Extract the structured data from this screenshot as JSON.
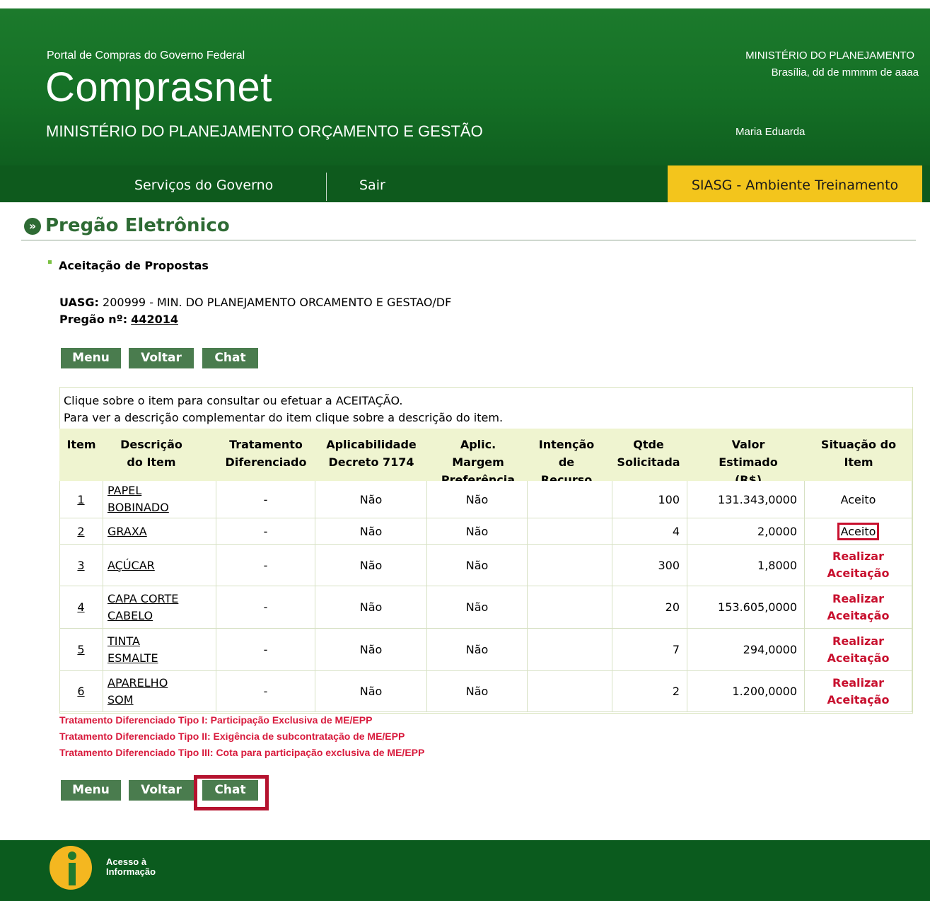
{
  "header": {
    "portal": "Portal de Compras do Governo Federal",
    "brand": "Comprasnet",
    "ministry": "MINISTÉRIO DO PLANEJAMENTO ORÇAMENTO E GESTÃO",
    "top_right": "MINISTÉRIO DO PLANEJAMENTO",
    "date": "Brasília, dd de mmmm de aaaa",
    "user": "Maria Eduarda"
  },
  "nav": {
    "items": [
      "Serviços do Governo",
      "Sair"
    ],
    "environment": "SIASG - Ambiente Treinamento"
  },
  "page": {
    "title": "Pregão Eletrônico",
    "subtitle": "Aceitação de Propostas",
    "uasg_label": "UASG:",
    "uasg_value": "200999 - MIN. DO PLANEJAMENTO ORCAMENTO E GESTAO/DF",
    "pregao_label": "Pregão nº:",
    "pregao_value": "442014"
  },
  "buttons": {
    "menu": "Menu",
    "voltar": "Voltar",
    "chat": "Chat"
  },
  "table": {
    "note1": "Clique sobre o item para consultar ou efetuar a ACEITAÇÃO.",
    "note2": "Para ver a descrição complementar do item clique sobre a descrição do item.",
    "headers": {
      "item": "Item",
      "descricao": "Descrição do Item",
      "tratamento": "Tratamento Diferenciado",
      "aplicabilidade": "Aplicabilidade Decreto 7174",
      "margem": "Aplic. Margem Preferência",
      "intencao": "Intenção de Recurso",
      "qtde": "Qtde Solicitada",
      "valor": "Valor Estimado (R$)",
      "situacao": "Situação do Item"
    },
    "rows": [
      {
        "item": "1",
        "descricao": "PAPEL BOBINADO",
        "tratamento": "-",
        "aplicabilidade": "Não",
        "margem": "Não",
        "intencao": "",
        "qtde": "100",
        "valor": "131.343,0000",
        "situacao": "Aceito"
      },
      {
        "item": "2",
        "descricao": "GRAXA",
        "tratamento": "-",
        "aplicabilidade": "Não",
        "margem": "Não",
        "intencao": "",
        "qtde": "4",
        "valor": "2,0000",
        "situacao": "Aceito"
      },
      {
        "item": "3",
        "descricao": "AÇÚCAR",
        "tratamento": "-",
        "aplicabilidade": "Não",
        "margem": "Não",
        "intencao": "",
        "qtde": "300",
        "valor": "1,8000",
        "situacao": "Realizar Aceitação"
      },
      {
        "item": "4",
        "descricao": "CAPA CORTE CABELO",
        "tratamento": "-",
        "aplicabilidade": "Não",
        "margem": "Não",
        "intencao": "",
        "qtde": "20",
        "valor": "153.605,0000",
        "situacao": "Realizar Aceitação"
      },
      {
        "item": "5",
        "descricao": "TINTA ESMALTE",
        "tratamento": "-",
        "aplicabilidade": "Não",
        "margem": "Não",
        "intencao": "",
        "qtde": "7",
        "valor": "294,0000",
        "situacao": "Realizar Aceitação"
      },
      {
        "item": "6",
        "descricao": "APARELHO SOM",
        "tratamento": "-",
        "aplicabilidade": "Não",
        "margem": "Não",
        "intencao": "",
        "qtde": "2",
        "valor": "1.200,0000",
        "situacao": "Realizar Aceitação"
      }
    ]
  },
  "legend": [
    "Tratamento Diferenciado Tipo I: Participação Exclusiva de ME/EPP",
    "Tratamento Diferenciado Tipo II: Exigência de subcontratação de ME/EPP",
    "Tratamento Diferenciado Tipo III: Cota para participação exclusiva de ME/EPP"
  ],
  "footer": {
    "logo_text_1": "Acesso à",
    "logo_text_2": "Informação"
  },
  "colors": {
    "header_green": "#157026",
    "nav_green": "#0e5a1d",
    "siasg_yellow": "#f3c51c",
    "button_green": "#4a7c4e",
    "alert_red": "#c8102e",
    "table_header_bg": "#eff4d0"
  }
}
